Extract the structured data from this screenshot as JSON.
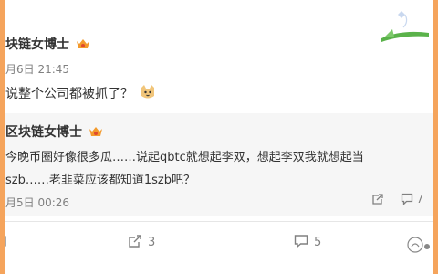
{
  "post": {
    "author": "块链女博士",
    "time": "月6日 21:45",
    "text": "说整个公司都被抓了？"
  },
  "repost": {
    "author": "区块链女博士",
    "line1": "今晚币圈好像很多瓜……说起qbtc就想起李双，想起李双我就想起当",
    "line2": "szb……老韭菜应该都知道1szb吧？",
    "time": "月5日 00:26",
    "repost_count": "",
    "comment_count": "7"
  },
  "actions": {
    "repost_count": "3",
    "comment_count": "5"
  }
}
